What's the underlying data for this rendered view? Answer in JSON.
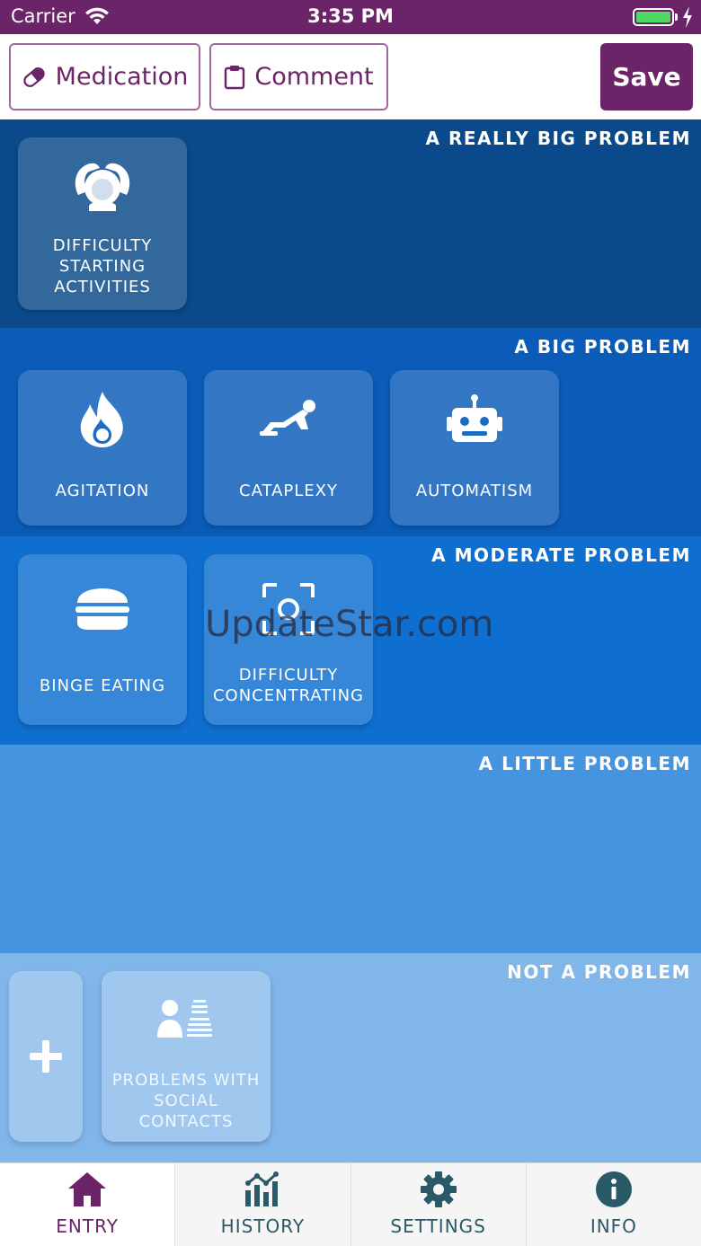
{
  "status_bar": {
    "carrier": "Carrier",
    "time": "3:35 PM"
  },
  "toolbar": {
    "medication_label": "Medication",
    "comment_label": "Comment",
    "save_label": "Save"
  },
  "sections": [
    {
      "title": "A REALLY BIG PROBLEM",
      "cards": [
        {
          "label": "DIFFICULTY STARTING ACTIVITIES",
          "icon": "head-hands-icon"
        }
      ]
    },
    {
      "title": "A BIG PROBLEM",
      "cards": [
        {
          "label": "AGITATION",
          "icon": "fire-icon"
        },
        {
          "label": "CATAPLEXY",
          "icon": "falling-person-icon"
        },
        {
          "label": "AUTOMATISM",
          "icon": "robot-icon"
        }
      ]
    },
    {
      "title": "A MODERATE PROBLEM",
      "cards": [
        {
          "label": "BINGE EATING",
          "icon": "burger-icon"
        },
        {
          "label": "DIFFICULTY CONCENTRATING",
          "icon": "focus-icon"
        }
      ]
    },
    {
      "title": "A LITTLE PROBLEM",
      "cards": []
    },
    {
      "title": "NOT A PROBLEM",
      "cards": [
        {
          "label": "PROBLEMS WITH SOCIAL CONTACTS",
          "icon": "people-icon"
        }
      ]
    }
  ],
  "watermark": "UpdateStar.com",
  "tabs": [
    {
      "label": "ENTRY",
      "icon": "home-icon",
      "active": true
    },
    {
      "label": "HISTORY",
      "icon": "chart-icon"
    },
    {
      "label": "SETTINGS",
      "icon": "gear-icon"
    },
    {
      "label": "INFO",
      "icon": "info-icon"
    }
  ],
  "colors": {
    "brand": "#6b2468",
    "tab_text": "#2a5968",
    "battery": "#4cd964"
  }
}
